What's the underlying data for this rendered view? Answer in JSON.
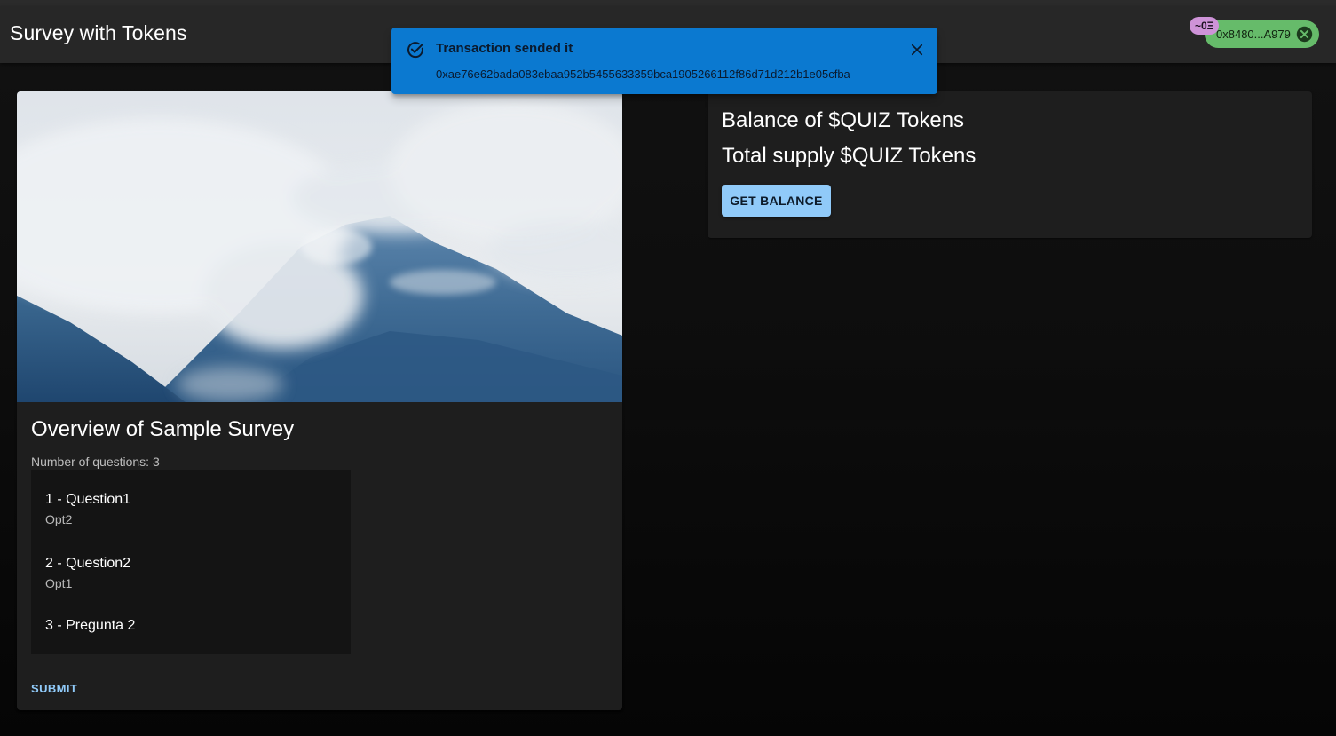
{
  "app": {
    "title": "Survey with Tokens"
  },
  "wallet": {
    "address": "0x8480...A979",
    "balance_badge": "~0Ξ",
    "chip_color": "#66bb6a",
    "badge_color": "#ce93d8",
    "close_icon": "cancel-circle-icon"
  },
  "notification": {
    "title": "Transaction sended it",
    "message": "0xae76e62bada083ebaa952b5455633359bca1905266112f86d71d212b1e05cfba",
    "color": "#0b79d0",
    "icon": "check-circle-icon",
    "close_icon": "close-icon"
  },
  "survey": {
    "image": "misty-mountain-photo",
    "title": "Overview of Sample Survey",
    "question_count_label": "Number of questions: 3",
    "questions": [
      {
        "title": "1 - Question1",
        "answer": "Opt2"
      },
      {
        "title": "2 - Question2",
        "answer": "Opt1"
      },
      {
        "title": "3 - Pregunta 2",
        "answer": ""
      }
    ],
    "submit_label": "SUBMIT"
  },
  "tokens": {
    "balance_label": "Balance of $QUIZ Tokens",
    "supply_label": "Total supply $QUIZ Tokens",
    "get_balance_label": "GET BALANCE",
    "accent_color": "#90caf9"
  }
}
